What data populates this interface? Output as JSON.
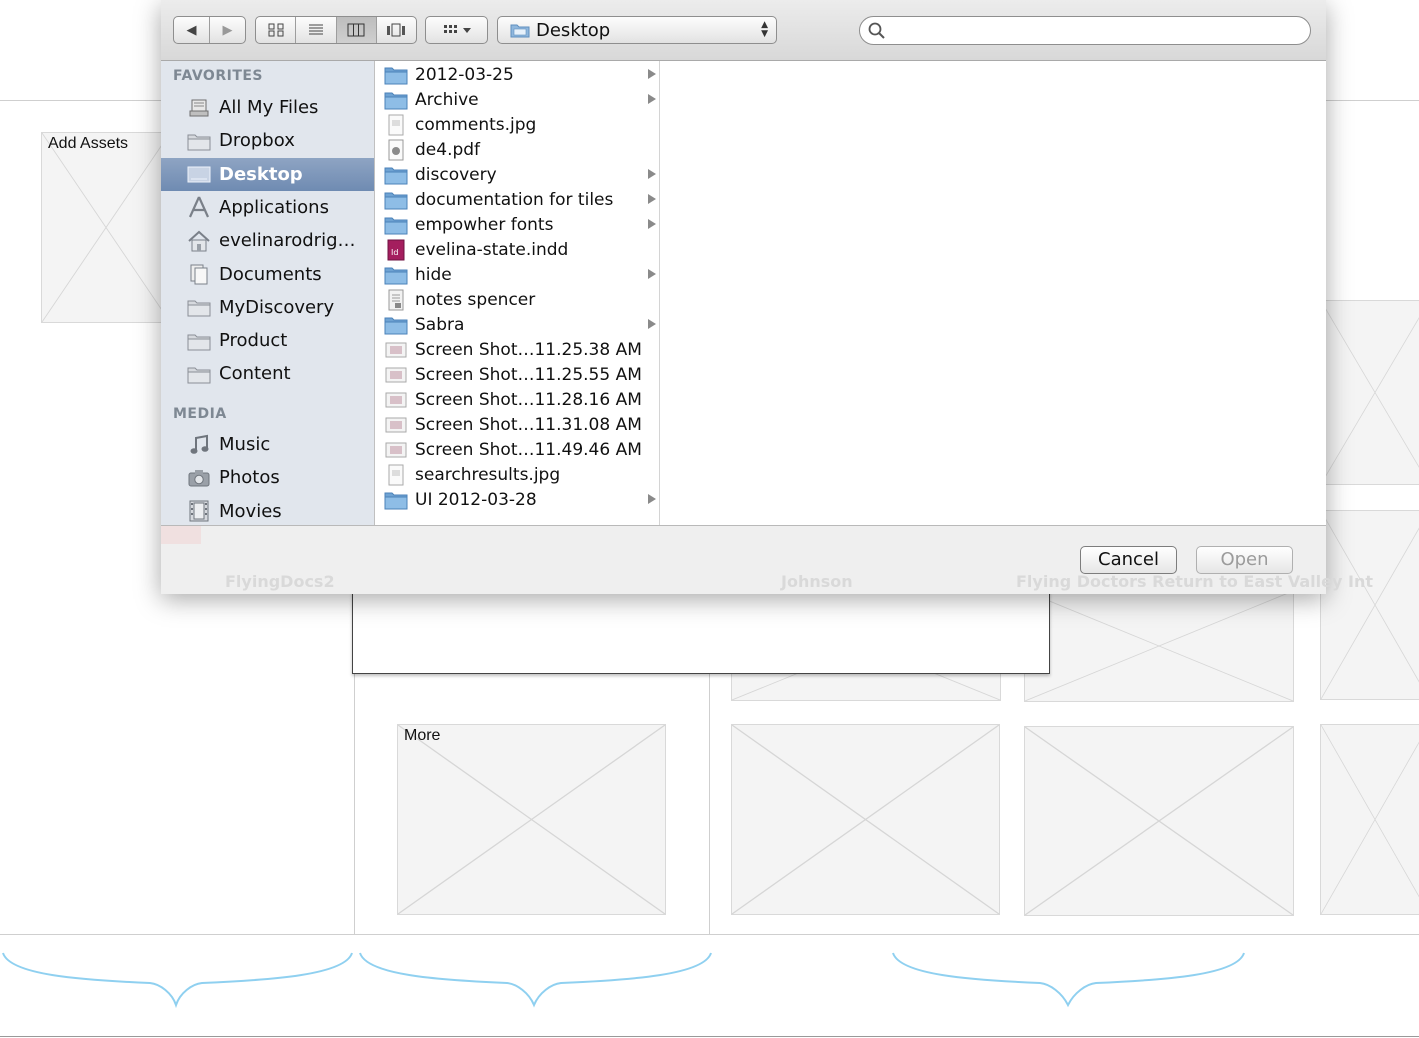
{
  "background": {
    "add_assets_label": "Add Assets",
    "more_label": "More"
  },
  "dialog": {
    "toolbar": {
      "back_label": "◀",
      "forward_label": "▶",
      "current_folder": "Desktop",
      "search_placeholder": ""
    },
    "sidebar": {
      "favorites_header": "FAVORITES",
      "favorites": [
        {
          "label": "All My Files",
          "icon": "all-files-icon"
        },
        {
          "label": "Dropbox",
          "icon": "folder-icon"
        },
        {
          "label": "Desktop",
          "icon": "desktop-icon",
          "selected": true
        },
        {
          "label": "Applications",
          "icon": "applications-icon"
        },
        {
          "label": "evelinarodrig…",
          "icon": "home-icon"
        },
        {
          "label": "Documents",
          "icon": "documents-icon"
        },
        {
          "label": "MyDiscovery",
          "icon": "folder-icon"
        },
        {
          "label": "Product",
          "icon": "folder-icon"
        },
        {
          "label": "Content",
          "icon": "folder-icon"
        }
      ],
      "media_header": "MEDIA",
      "media": [
        {
          "label": "Music",
          "icon": "music-icon"
        },
        {
          "label": "Photos",
          "icon": "camera-icon"
        },
        {
          "label": "Movies",
          "icon": "film-icon"
        }
      ]
    },
    "files": [
      {
        "name": "2012-03-25",
        "type": "folder"
      },
      {
        "name": "Archive",
        "type": "folder"
      },
      {
        "name": "comments.jpg",
        "type": "image"
      },
      {
        "name": "de4.pdf",
        "type": "pdf"
      },
      {
        "name": "discovery",
        "type": "folder"
      },
      {
        "name": "documentation for tiles",
        "type": "folder"
      },
      {
        "name": "empowher fonts",
        "type": "folder"
      },
      {
        "name": "evelina-state.indd",
        "type": "indd"
      },
      {
        "name": "hide",
        "type": "folder"
      },
      {
        "name": "notes spencer",
        "type": "doc"
      },
      {
        "name": "Sabra",
        "type": "folder"
      },
      {
        "name": "Screen Shot…11.25.38 AM",
        "type": "screenshot"
      },
      {
        "name": "Screen Shot…11.25.55 AM",
        "type": "screenshot"
      },
      {
        "name": "Screen Shot…11.28.16 AM",
        "type": "screenshot"
      },
      {
        "name": "Screen Shot…11.31.08 AM",
        "type": "screenshot"
      },
      {
        "name": "Screen Shot…11.49.46 AM",
        "type": "screenshot"
      },
      {
        "name": "searchresults.jpg",
        "type": "image"
      },
      {
        "name": "UI 2012-03-28",
        "type": "folder"
      }
    ],
    "buttons": {
      "cancel": "Cancel",
      "open": "Open"
    },
    "ghost_texts": [
      "FlyingDocs2",
      "Johnson",
      "Flying Doctors Return to East Valley Int"
    ]
  }
}
